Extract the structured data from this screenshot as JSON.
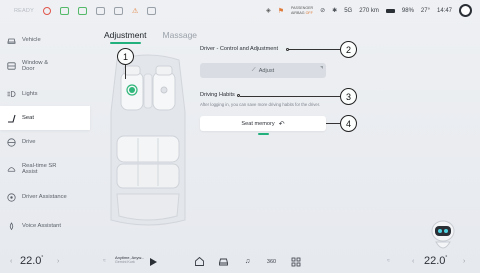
{
  "status": {
    "ready": "READY",
    "passenger_airbag_line1": "PASSENGER",
    "passenger_airbag_line2": "AIRBAG",
    "passenger_airbag_state": "OFF",
    "signal": "5G",
    "range": "270 km",
    "battery": "98%",
    "outside_temp": "27°",
    "time": "14:47"
  },
  "sidebar": {
    "items": [
      {
        "label": "Vehicle"
      },
      {
        "label": "Window & Door"
      },
      {
        "label": "Lights"
      },
      {
        "label": "Seat"
      },
      {
        "label": "Drive"
      },
      {
        "label": "Real-time SR Assist"
      },
      {
        "label": "Driver Assistance"
      },
      {
        "label": "Voice Assistant"
      }
    ],
    "active_index": 3
  },
  "tabs": [
    {
      "label": "Adjustment"
    },
    {
      "label": "Massage"
    }
  ],
  "panel": {
    "driver_title": "Driver - Control and Adjustment",
    "adjust_label": "Adjust",
    "habits_title": "Driving Habits",
    "habits_desc": "After logging in, you can save more driving habits for the driver.",
    "memory_label": "Seat memory"
  },
  "callouts": [
    "1",
    "2",
    "3",
    "4"
  ],
  "bottom": {
    "temp_left": "22.0",
    "temp_right": "22.0",
    "temp_unit": "°",
    "music_title": "Anytime, Anyw...",
    "music_artist": "Gemini Kurk",
    "fan_left": "≈",
    "fan_right": "≈",
    "dock_360": "360"
  },
  "colors": {
    "accent": "#22b07d",
    "active_seat": "#2fb67a"
  }
}
